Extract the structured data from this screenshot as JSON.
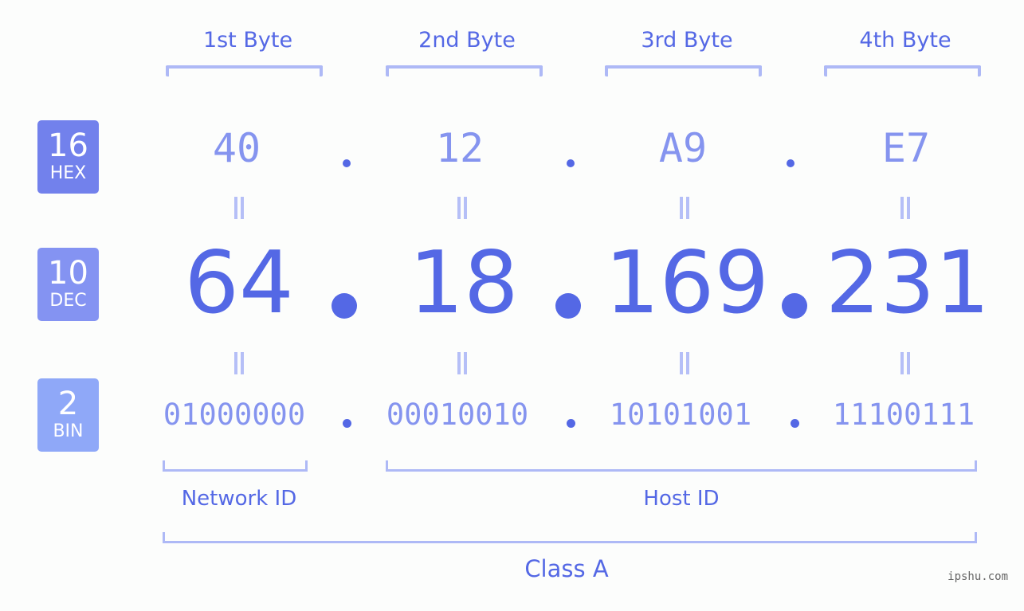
{
  "badges": [
    {
      "number": "16",
      "label": "HEX",
      "color": "#7281ec"
    },
    {
      "number": "10",
      "label": "DEC",
      "color": "#8493f2"
    },
    {
      "number": "2",
      "label": "BIN",
      "color": "#8fa8f8"
    }
  ],
  "bytes": [
    {
      "header": "1st Byte",
      "hex": "40",
      "dec": "64",
      "bin": "01000000"
    },
    {
      "header": "2nd Byte",
      "hex": "12",
      "dec": "18",
      "bin": "00010010"
    },
    {
      "header": "3rd Byte",
      "hex": "A9",
      "dec": "169",
      "bin": "10101001"
    },
    {
      "header": "4th Byte",
      "hex": "E7",
      "dec": "231",
      "bin": "11100111"
    }
  ],
  "groups": {
    "network": "Network ID",
    "host": "Host ID",
    "class": "Class A"
  },
  "footer": "ipshu.com",
  "colors": {
    "accent": "#5468e5",
    "light": "#8594ef",
    "bracket": "#aeb9f6"
  }
}
